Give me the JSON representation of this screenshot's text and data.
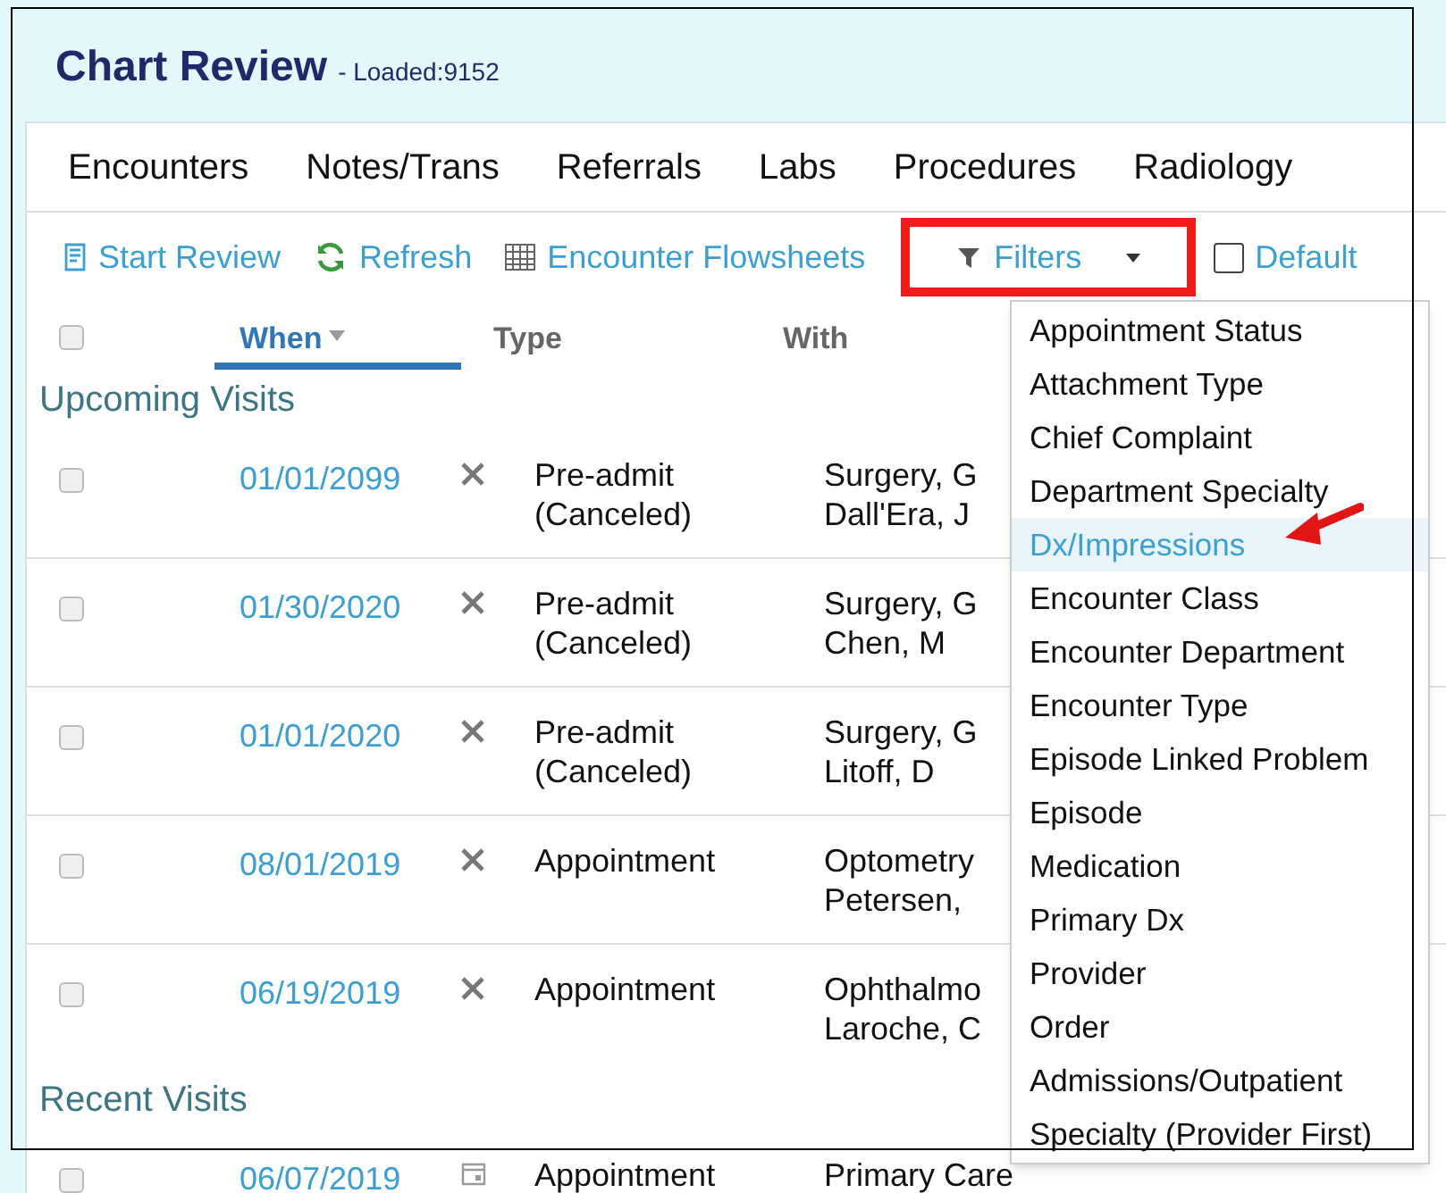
{
  "window": {
    "title": "Chart Review",
    "subtitle": "- Loaded:9152"
  },
  "tabs": [
    "Encounters",
    "Notes/Trans",
    "Referrals",
    "Labs",
    "Procedures",
    "Radiology"
  ],
  "toolbar": [
    {
      "kind": "review",
      "label": "Start Review"
    },
    {
      "kind": "refresh",
      "label": "Refresh"
    },
    {
      "kind": "flowsheet",
      "label": "Encounter Flowsheets"
    },
    {
      "kind": "filter",
      "label": "Filters",
      "annotated": true
    },
    {
      "kind": "checkbox",
      "label": "Default",
      "checked": false
    }
  ],
  "table": {
    "select_all": {
      "checked": false
    },
    "columns": [
      {
        "label": "When",
        "sorted": true
      },
      {
        "label": "Type",
        "sorted": false
      },
      {
        "label": "With",
        "sorted": false
      }
    ],
    "sections": [
      {
        "title": "Upcoming Visits",
        "rows": [
          {
            "checked": false,
            "date": "01/01/2099",
            "kind": "cancel",
            "type": [
              "Pre-admit",
              "(Canceled)"
            ],
            "with": [
              "Surgery, G",
              "Dall'Era, J"
            ]
          },
          {
            "checked": false,
            "date": "01/30/2020",
            "kind": "cancel",
            "type": [
              "Pre-admit",
              "(Canceled)"
            ],
            "with": [
              "Surgery, G",
              "Chen, M"
            ]
          },
          {
            "checked": false,
            "date": "01/01/2020",
            "kind": "cancel",
            "type": [
              "Pre-admit",
              "(Canceled)"
            ],
            "with": [
              "Surgery, G",
              "Litoff, D"
            ]
          },
          {
            "checked": false,
            "date": "08/01/2019",
            "kind": "cancel",
            "type": [
              "Appointment"
            ],
            "with": [
              "Optometry",
              "Petersen,"
            ]
          },
          {
            "checked": false,
            "date": "06/19/2019",
            "kind": "cancel",
            "type": [
              "Appointment"
            ],
            "with": [
              "Ophthalmo",
              "Laroche, C"
            ]
          }
        ]
      },
      {
        "title": "Recent Visits",
        "rows": [
          {
            "checked": false,
            "date": "06/07/2019",
            "kind": "appointment",
            "type": [
              "Appointment"
            ],
            "with": [
              "Primary Care"
            ]
          }
        ]
      }
    ]
  },
  "filters_menu": {
    "items": [
      {
        "label": "Appointment Status",
        "selected": false
      },
      {
        "label": "Attachment Type",
        "selected": false
      },
      {
        "label": "Chief Complaint",
        "selected": false
      },
      {
        "label": "Department Specialty",
        "selected": false
      },
      {
        "label": "Dx/Impressions",
        "selected": true
      },
      {
        "label": "Encounter Class",
        "selected": false
      },
      {
        "label": "Encounter Department",
        "selected": false
      },
      {
        "label": "Encounter Type",
        "selected": false
      },
      {
        "label": "Episode Linked Problem",
        "selected": false
      },
      {
        "label": "Episode",
        "selected": false
      },
      {
        "label": "Medication",
        "selected": false
      },
      {
        "label": "Primary Dx",
        "selected": false
      },
      {
        "label": "Provider",
        "selected": false
      },
      {
        "label": "Order",
        "selected": false
      },
      {
        "label": "Admissions/Outpatient",
        "selected": false
      },
      {
        "label": "Specialty (Provider First)",
        "selected": false
      }
    ]
  }
}
